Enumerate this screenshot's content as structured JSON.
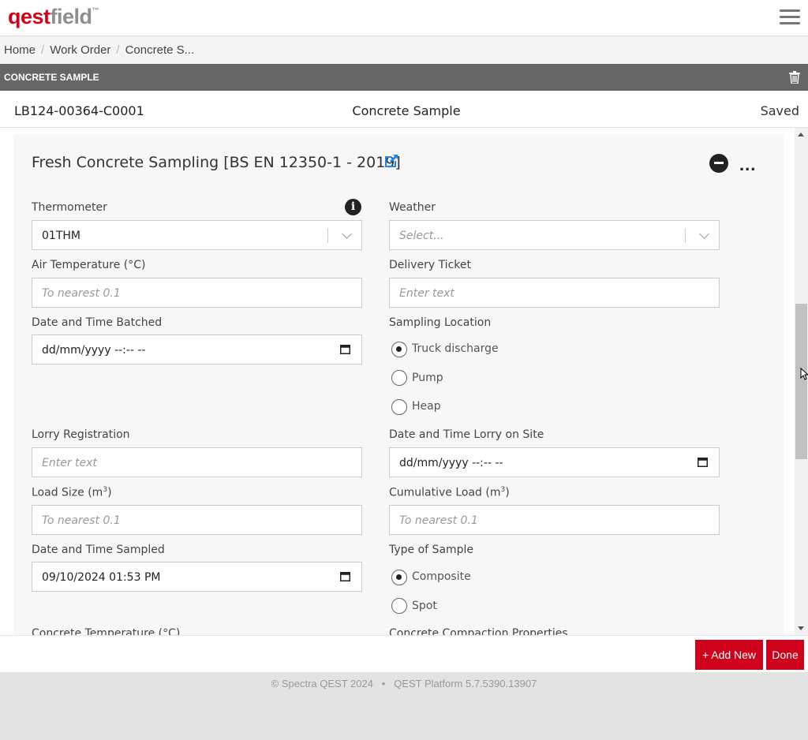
{
  "app": {
    "logo_left": "qest",
    "logo_right": "field",
    "logo_tm": "™"
  },
  "breadcrumb": {
    "items": [
      "Home",
      "Work Order",
      "Concrete S..."
    ]
  },
  "section_bar": {
    "title": "CONCRETE SAMPLE",
    "delete_icon": "trash-icon"
  },
  "record": {
    "id": "LB124-00364-C0001",
    "title": "Concrete Sample",
    "status": "Saved"
  },
  "form": {
    "title": "Fresh Concrete Sampling [BS EN 12350-1 - 2019]",
    "thermometer": {
      "label": "Thermometer",
      "value": "01THM"
    },
    "weather": {
      "label": "Weather",
      "placeholder": "Select..."
    },
    "air_temperature": {
      "label": "Air Temperature (°C)",
      "placeholder": "To nearest 0.1"
    },
    "delivery_ticket": {
      "label": "Delivery Ticket",
      "placeholder": "Enter text"
    },
    "date_time_batched": {
      "label": "Date and Time Batched",
      "value": "dd/mm/yyyy --:-- --"
    },
    "sampling_location": {
      "label": "Sampling Location",
      "options": [
        "Truck discharge",
        "Pump",
        "Heap"
      ],
      "selected": "Truck discharge"
    },
    "lorry_registration": {
      "label": "Lorry Registration",
      "placeholder": "Enter text"
    },
    "date_time_lorry_on_site": {
      "label": "Date and Time Lorry on Site",
      "value": "dd/mm/yyyy --:-- --"
    },
    "load_size": {
      "label": "Load Size (m",
      "sup": "3",
      "label_end": ")",
      "placeholder": "To nearest 0.1"
    },
    "cumulative_load": {
      "label": "Cumulative Load (m",
      "sup": "3",
      "label_end": ")",
      "placeholder": "To nearest 0.1"
    },
    "date_time_sampled": {
      "label": "Date and Time Sampled",
      "value": "09/10/2024 01:53 PM"
    },
    "type_of_sample": {
      "label": "Type of Sample",
      "options": [
        "Composite",
        "Spot"
      ],
      "selected": "Composite"
    },
    "concrete_temperature": {
      "label": "Concrete Temperature (°C)"
    },
    "concrete_compaction": {
      "label": "Concrete Compaction Properties"
    }
  },
  "actions": {
    "add_new": "+ Add New",
    "done": "Done"
  },
  "footer": {
    "copyright": "© Spectra QEST 2024",
    "bullet": "•",
    "platform": "QEST Platform 5.7.5390.13907"
  },
  "colors": {
    "brand_red": "#d0021b",
    "dark_bar": "#666666",
    "link_blue": "#1e88e5"
  }
}
